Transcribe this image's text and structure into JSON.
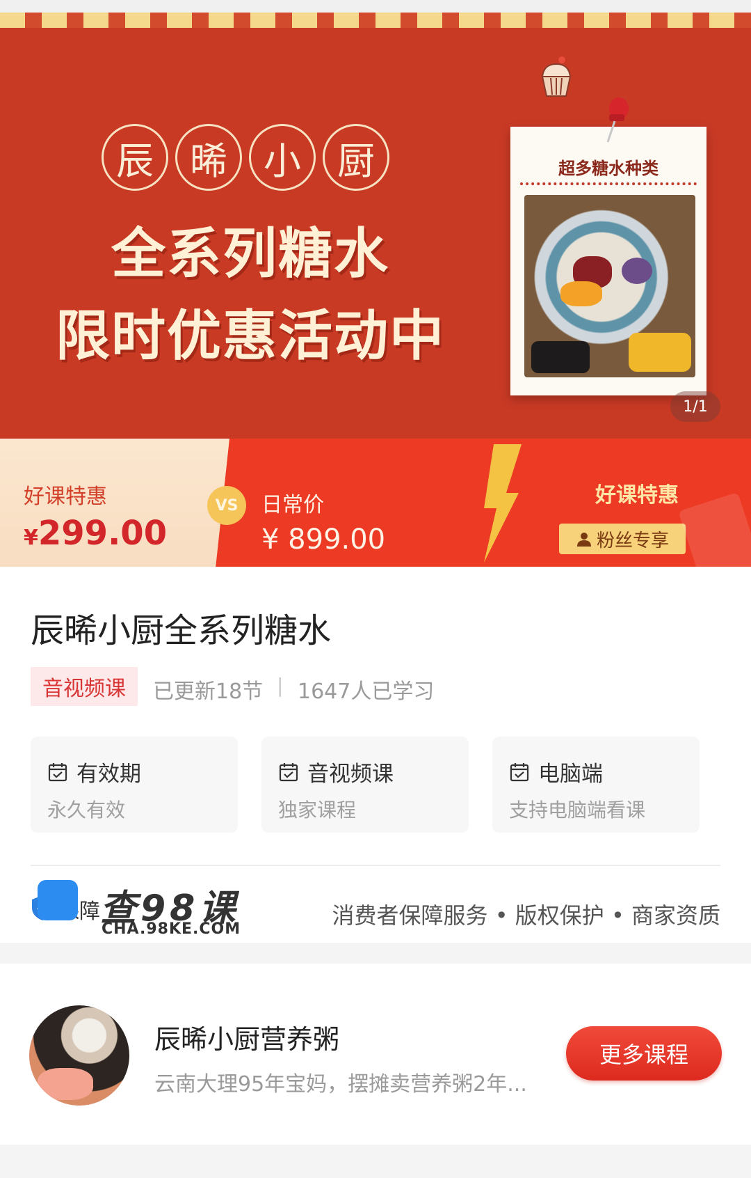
{
  "banner": {
    "circle_chars": [
      "辰",
      "晞",
      "小",
      "厨"
    ],
    "headline_1": "全系列糖水",
    "headline_2": "限时优惠活动中",
    "photo_title": "超多糖水种类",
    "page_indicator": "1/1",
    "icons": [
      "cupcake-icon",
      "pushpin-icon"
    ]
  },
  "price": {
    "left_label": "好课特惠",
    "currency": "¥",
    "left_amount": "299.00",
    "vs": "VS",
    "mid_label": "日常价",
    "mid_amount": "¥ 899.00",
    "right_label": "好课特惠",
    "fan_badge": "粉丝专享",
    "colors": {
      "accent": "#ec3a24",
      "cream": "#fbe7cf",
      "gold": "#f8d27b"
    }
  },
  "course": {
    "title": "辰晞小厨全系列糖水",
    "type_tag": "音视频课",
    "updates": "已更新18节",
    "separator": "|",
    "learners": "1647人已学习",
    "features": [
      {
        "title": "有效期",
        "sub": "永久有效",
        "icon": "calendar-icon"
      },
      {
        "title": "音视频课",
        "sub": "独家课程",
        "icon": "calendar-icon"
      },
      {
        "title": "电脑端",
        "sub": "支持电脑端看课",
        "icon": "calendar-icon"
      }
    ]
  },
  "guarantee": {
    "label": "保障",
    "services": "消费者保障服务 • 版权保护 • 商家资质",
    "watermark_text": "查98课",
    "watermark_url": "CHA.98KE.COM"
  },
  "author": {
    "name": "辰晞小厨营养粥",
    "desc": "云南大理95年宝妈，摆摊卖营养粥2年...",
    "more_button": "更多课程"
  }
}
